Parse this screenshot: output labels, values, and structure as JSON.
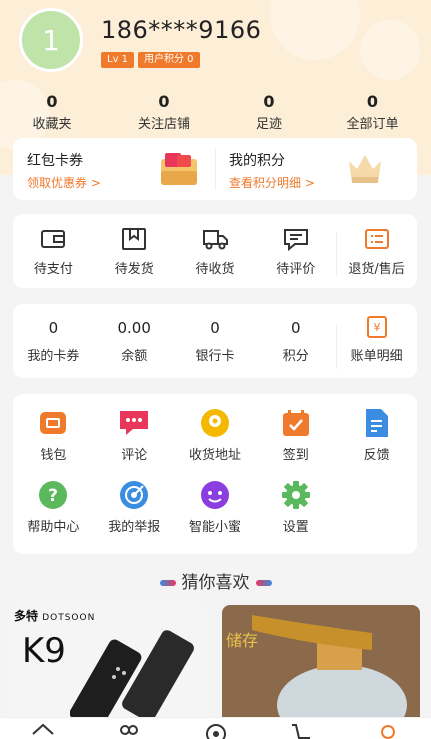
{
  "profile": {
    "avatar_initial": "1",
    "phone": "186****9166",
    "level_badge": "Lv 1",
    "points_badge": "用户积分 0"
  },
  "stats": [
    {
      "value": "0",
      "label": "收藏夹"
    },
    {
      "value": "0",
      "label": "关注店铺"
    },
    {
      "value": "0",
      "label": "足迹"
    },
    {
      "value": "0",
      "label": "全部订单"
    }
  ],
  "promo": {
    "left": {
      "title": "红包卡券",
      "link": "领取优惠券 >",
      "icon": "red-packet-icon"
    },
    "right": {
      "title": "我的积分",
      "link": "查看积分明细 >",
      "icon": "crown-icon"
    }
  },
  "orders": [
    {
      "label": "待支付",
      "icon": "wallet-icon"
    },
    {
      "label": "待发货",
      "icon": "box-icon"
    },
    {
      "label": "待收货",
      "icon": "truck-icon"
    },
    {
      "label": "待评价",
      "icon": "comment-icon"
    },
    {
      "label": "退货/售后",
      "icon": "return-list-icon"
    }
  ],
  "assets": [
    {
      "value": "0",
      "label": "我的卡券"
    },
    {
      "value": "0.00",
      "label": "余额"
    },
    {
      "value": "0",
      "label": "银行卡"
    },
    {
      "value": "0",
      "label": "积分"
    },
    {
      "label": "账单明细",
      "icon": "bill-icon"
    }
  ],
  "tools": [
    {
      "label": "钱包",
      "icon": "wallet-icon",
      "color": "#f07a2c"
    },
    {
      "label": "评论",
      "icon": "comment-icon",
      "color": "#e8375a"
    },
    {
      "label": "收货地址",
      "icon": "location-icon",
      "color": "#f5b800"
    },
    {
      "label": "签到",
      "icon": "calendar-check-icon",
      "color": "#f07a2c"
    },
    {
      "label": "反馈",
      "icon": "feedback-doc-icon",
      "color": "#3a8de0"
    },
    {
      "label": "帮助中心",
      "icon": "help-icon",
      "color": "#5cb85c"
    },
    {
      "label": "我的举报",
      "icon": "report-target-icon",
      "color": "#3a8de0"
    },
    {
      "label": "智能小蜜",
      "icon": "assistant-icon",
      "color": "#8a3ee0"
    },
    {
      "label": "设置",
      "icon": "gear-icon",
      "color": "#5cb85c"
    }
  ],
  "guess_title": "猜你喜欢",
  "products": [
    {
      "brand": "多特",
      "brand_en": "DOTSOON",
      "model": "K9"
    },
    {
      "tag": "储存"
    }
  ],
  "tabbar": [
    "home-icon",
    "category-icon",
    "discover-icon",
    "cart-icon",
    "profile-icon"
  ]
}
